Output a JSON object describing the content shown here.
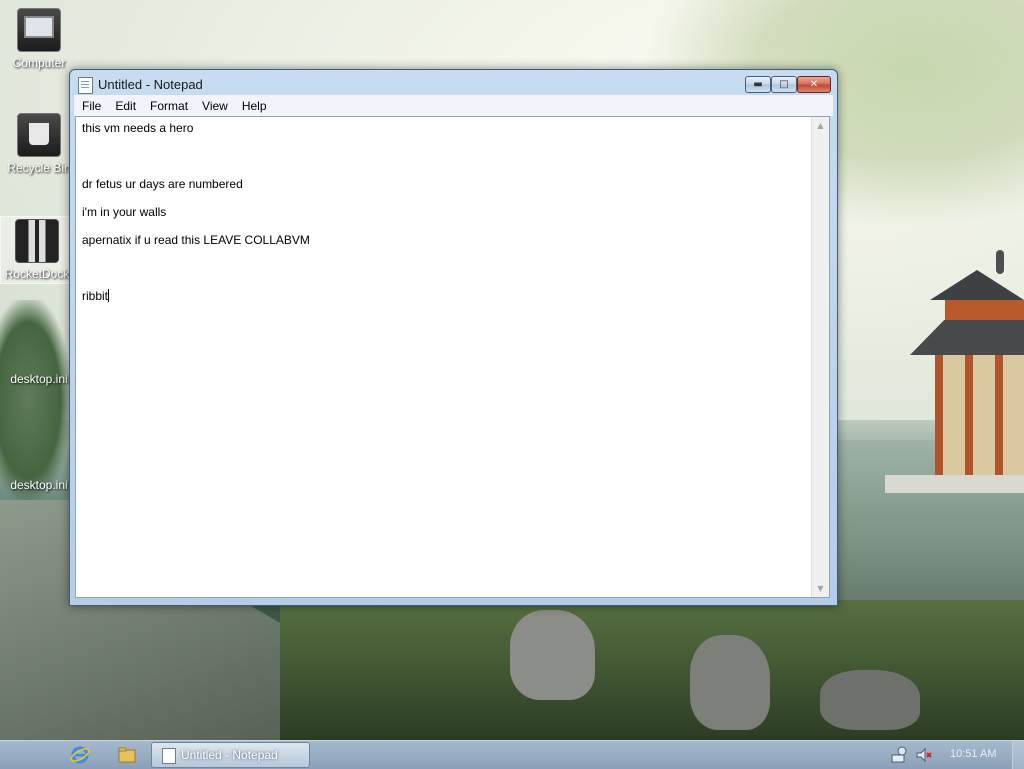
{
  "desktop": {
    "icons": [
      {
        "label": "Computer",
        "icon": "computer-icon"
      },
      {
        "label": "Recycle Bin",
        "icon": "recycle-bin-icon"
      },
      {
        "label": "RocketDock",
        "icon": "rocketdock-icon"
      },
      {
        "label": "desktop.ini",
        "icon": "file-icon"
      },
      {
        "label": "desktop.ini",
        "icon": "file-icon"
      }
    ]
  },
  "window": {
    "title": "Untitled - Notepad",
    "menu": [
      "File",
      "Edit",
      "Format",
      "View",
      "Help"
    ],
    "buttons": {
      "minimize": "minimize-icon",
      "maximize": "maximize-icon",
      "close": "close-icon"
    },
    "content_lines": [
      "this vm needs a hero",
      "",
      "",
      "",
      "dr fetus ur days are numbered",
      "",
      "i'm in your walls",
      "",
      "apernatix if u read this LEAVE COLLABVM",
      "",
      "",
      "",
      "ribbit"
    ]
  },
  "taskbar": {
    "pinned": [
      "internet-explorer-icon",
      "windows-explorer-icon"
    ],
    "active_task": "Untitled - Notepad",
    "tray": [
      "network-icon",
      "volume-muted-icon"
    ],
    "clock": "10:51 AM"
  },
  "colors": {
    "titlebar": "#b6cde6",
    "close_button": "#c0442b",
    "taskbar": "#8ba0b8"
  }
}
